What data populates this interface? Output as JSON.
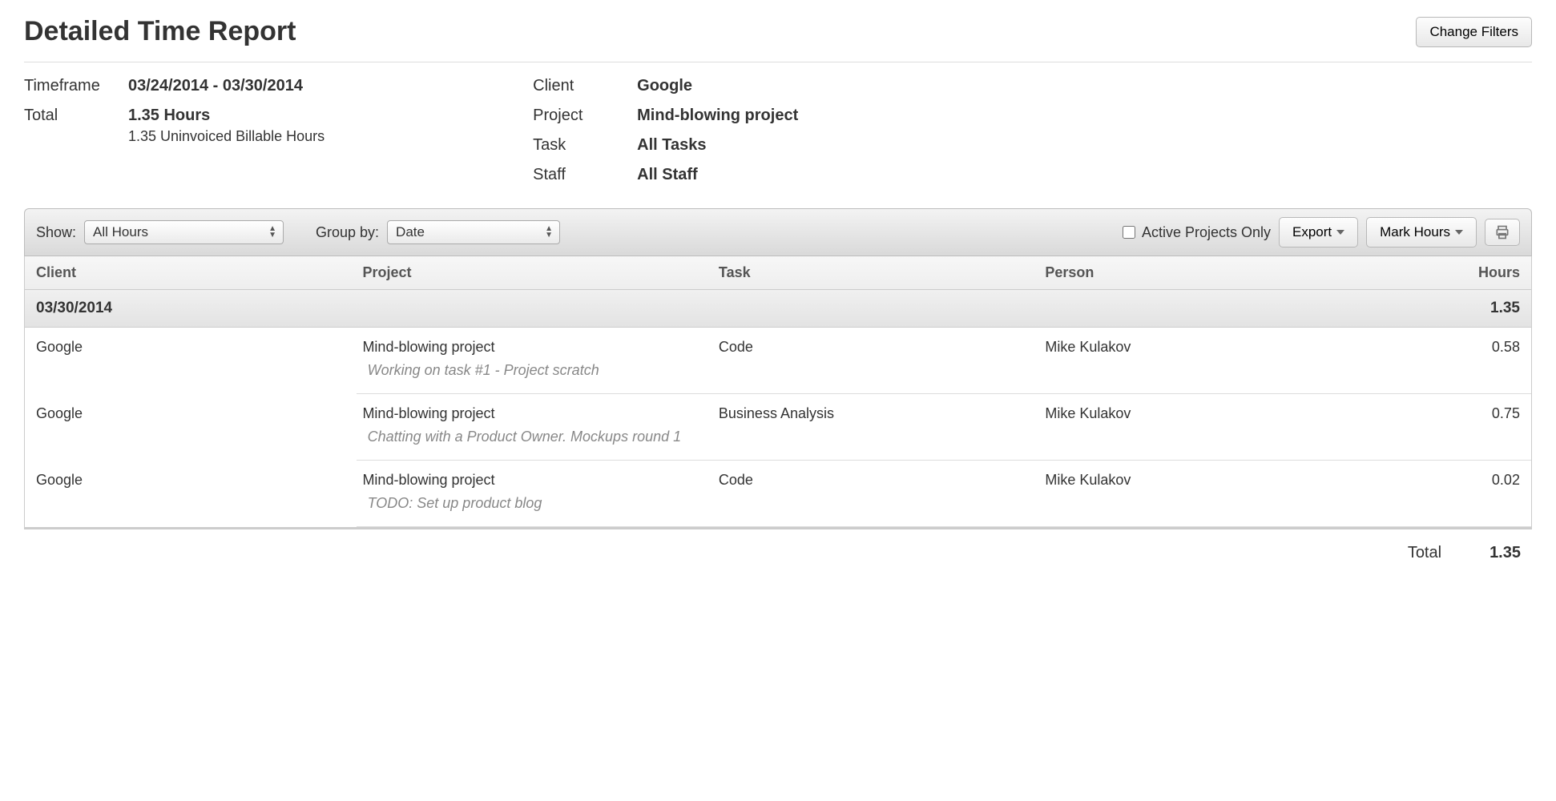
{
  "header": {
    "title": "Detailed Time Report",
    "change_filters": "Change Filters"
  },
  "summary": {
    "left": {
      "timeframe_label": "Timeframe",
      "timeframe_value": "03/24/2014 - 03/30/2014",
      "total_label": "Total",
      "total_value": "1.35 Hours",
      "total_sub": "1.35 Uninvoiced Billable Hours"
    },
    "right": {
      "client_label": "Client",
      "client_value": "Google",
      "project_label": "Project",
      "project_value": "Mind-blowing project",
      "task_label": "Task",
      "task_value": "All Tasks",
      "staff_label": "Staff",
      "staff_value": "All Staff"
    }
  },
  "toolbar": {
    "show_label": "Show:",
    "show_value": "All Hours",
    "group_label": "Group by:",
    "group_value": "Date",
    "active_only": "Active Projects Only",
    "export": "Export",
    "mark_hours": "Mark Hours"
  },
  "table": {
    "headers": {
      "client": "Client",
      "project": "Project",
      "task": "Task",
      "person": "Person",
      "hours": "Hours"
    },
    "group": {
      "date": "03/30/2014",
      "hours": "1.35"
    },
    "rows": [
      {
        "client": "Google",
        "project": "Mind-blowing project",
        "task": "Code",
        "person": "Mike Kulakov",
        "hours": "0.58",
        "note": "Working on task #1 - Project scratch"
      },
      {
        "client": "Google",
        "project": "Mind-blowing project",
        "task": "Business Analysis",
        "person": "Mike Kulakov",
        "hours": "0.75",
        "note": "Chatting with a Product Owner. Mockups round 1"
      },
      {
        "client": "Google",
        "project": "Mind-blowing project",
        "task": "Code",
        "person": "Mike Kulakov",
        "hours": "0.02",
        "note": "TODO: Set up product blog"
      }
    ],
    "footer": {
      "label": "Total",
      "value": "1.35"
    }
  }
}
